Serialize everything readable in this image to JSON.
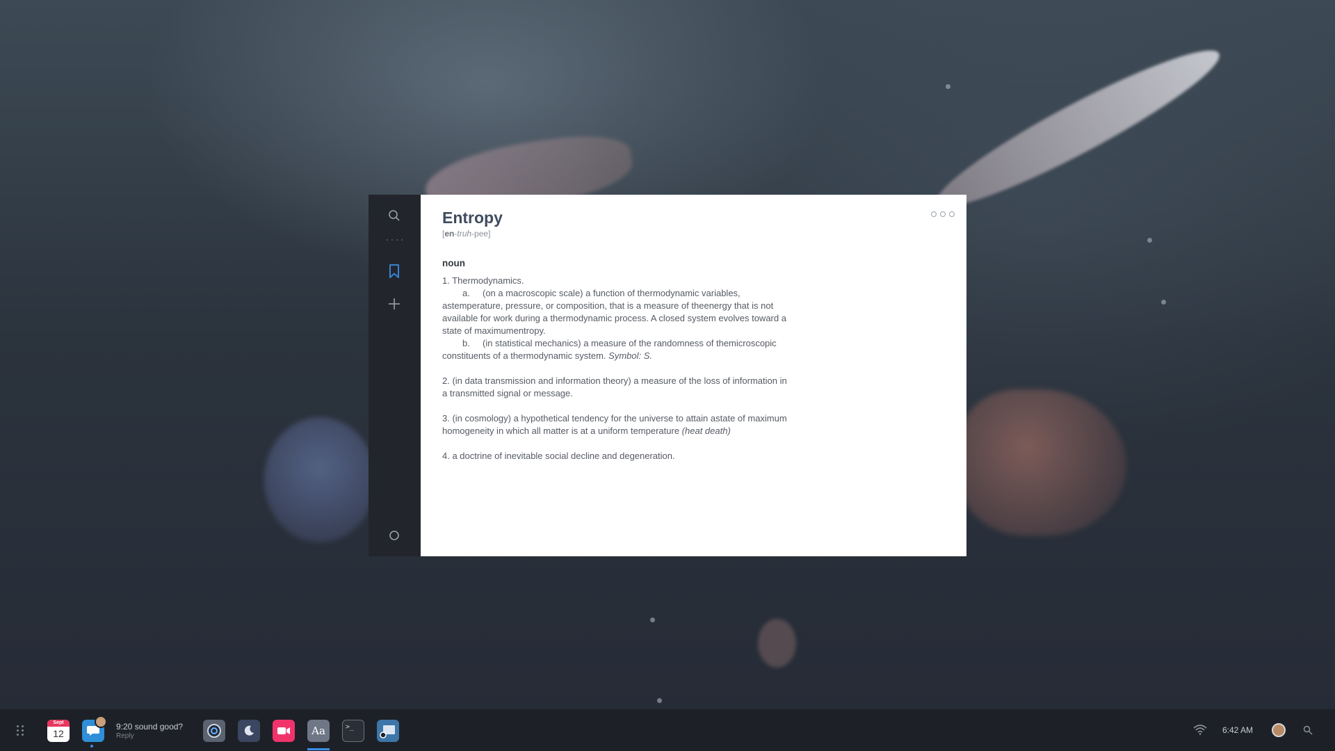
{
  "dictionary": {
    "word": "Entropy",
    "pronunciation": {
      "part1": "en",
      "sep1": "-",
      "part2": "truh",
      "sep2": "-",
      "part3": "pee"
    },
    "part_of_speech": "noun",
    "senses": {
      "s1_title": "1. Thermodynamics.",
      "s1a_label": "a.",
      "s1a_text": "(on a macroscopic scale) a function of thermodynamic variables, astemperature, pressure, or composition, that is a measure of theenergy that is not available for work during a thermodynamic process. A closed system evolves toward a state of maximumentropy.",
      "s1b_label": "b.",
      "s1b_text": "(in statistical mechanics) a measure of the randomness of themicroscopic constituents of a thermodynamic system.",
      "s1b_symbol": "Symbol: S.",
      "s2_text": "2. (in data transmission and information theory) a measure of the loss of information in a transmitted signal or message.",
      "s3_text": "3. (in cosmology) a hypothetical tendency for the universe to attain astate of maximum homogeneity in which all matter is at a uniform temperature",
      "s3_note": "(heat death)",
      "s4_text": "4. a doctrine of inevitable social decline and degeneration."
    }
  },
  "sidebar": {
    "icons": [
      "search-icon",
      "bookmark-icon",
      "plus-icon",
      "circle-icon"
    ]
  },
  "taskbar": {
    "calendar": {
      "month": "Sept",
      "day": "12"
    },
    "notification": {
      "message": "9:20 sound good?",
      "action": "Reply"
    },
    "dictionary_app_label": "Aa",
    "terminal_label": ">_",
    "clock": "6:42 AM"
  },
  "colors": {
    "accent": "#3b8eea",
    "title": "#414b5e",
    "sidebar_bg": "#22262c",
    "taskbar_bg": "#1d2127"
  }
}
